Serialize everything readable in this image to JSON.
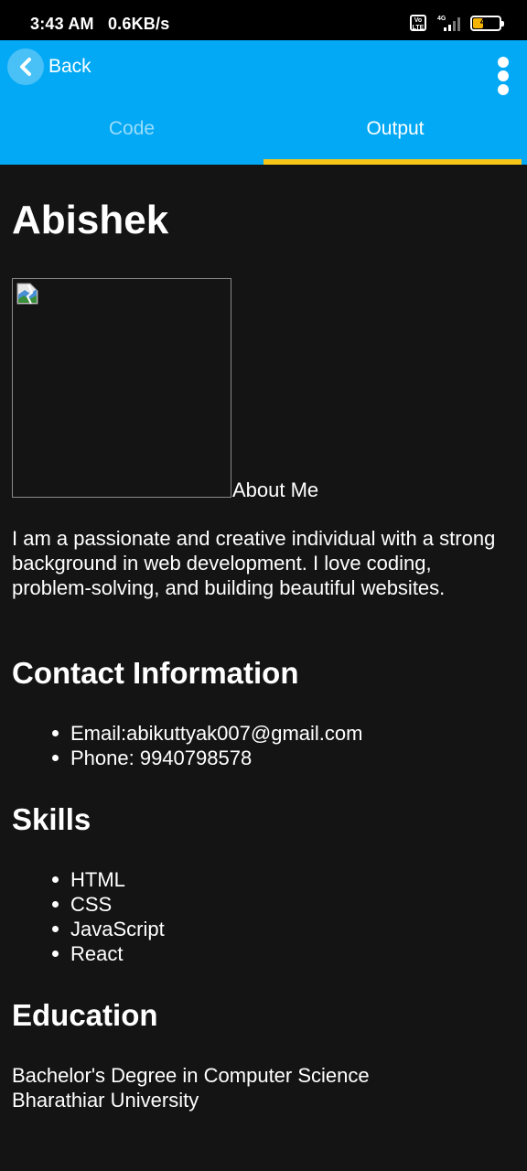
{
  "status_bar": {
    "time": "3:43 AM",
    "speed": "0.6KB/s",
    "volte": "Vo LTE",
    "network": "4G",
    "battery": "44",
    "battery_level": 0.44,
    "battery_color": "#f4b400"
  },
  "app_bar": {
    "back_label": "Back",
    "color": "#03a9f4",
    "tabs": [
      {
        "label": "Code",
        "selected": false
      },
      {
        "label": "Output",
        "selected": true
      }
    ],
    "indicator_color": "#f5c518"
  },
  "page": {
    "title": "Abishek",
    "about_heading": "About Me",
    "about_text": "I am a passionate and creative individual with a strong background in web development. I love coding, problem-solving, and building beautiful websites.",
    "contact": {
      "heading": "Contact Information",
      "items": [
        "Email:abikuttyak007@gmail.com",
        "Phone: 9940798578"
      ]
    },
    "skills": {
      "heading": "Skills",
      "items": [
        "HTML",
        "CSS",
        "JavaScript",
        "React"
      ]
    },
    "education": {
      "heading": "Education",
      "degree": "Bachelor's Degree in Computer Science",
      "university": "Bharathiar University"
    }
  }
}
